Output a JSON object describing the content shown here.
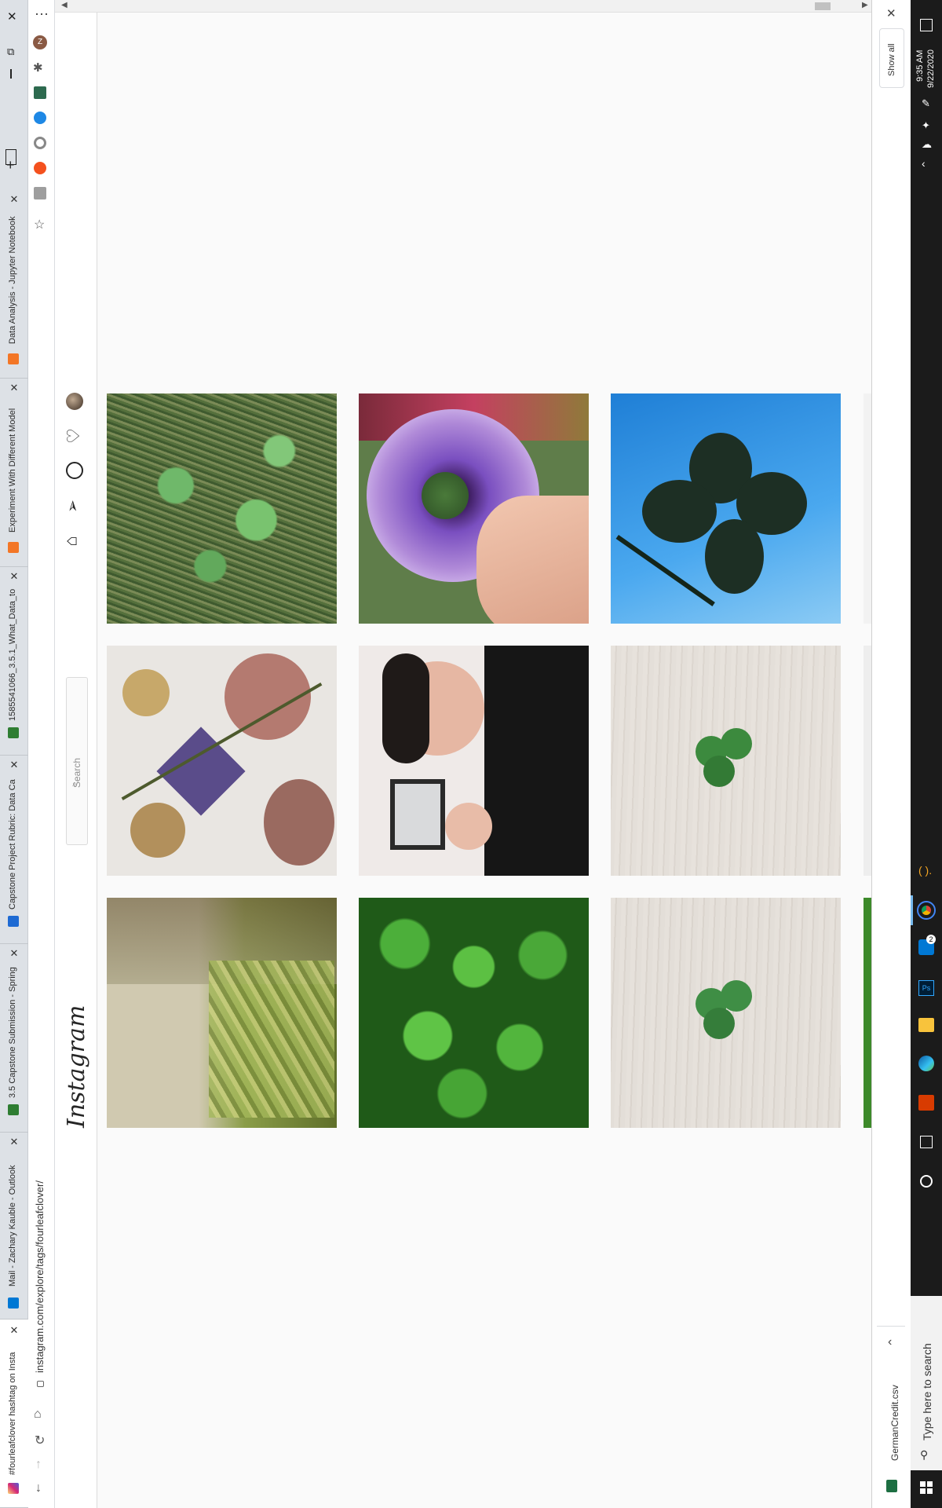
{
  "browser": {
    "tabs": [
      {
        "label": "#fourleafclover hashtag on Insta",
        "fav": "#d6249f",
        "active": true
      },
      {
        "label": "Mail - Zachary Kauble - Outlook",
        "fav": "#0078d4"
      },
      {
        "label": "3.5 Capstone Submission - Spring",
        "fav": "#2e7d32"
      },
      {
        "label": "Capstone Project Rubric: Data Ca",
        "fav": "#1e6ad3"
      },
      {
        "label": "1585541066_3.5.1_What_Data_to",
        "fav": "#2e7d32"
      },
      {
        "label": "Experiment With Different Model",
        "fav": "#f37626"
      },
      {
        "label": "Data Analysis - Jupyter Notebook",
        "fav": "#f37626"
      }
    ],
    "url": "instagram.com/explore/tags/fourleafclover/",
    "window_controls": {
      "close": "✕",
      "restore": "⧉",
      "minimize": "—"
    },
    "new_tab": "+",
    "menu": "⋯"
  },
  "instagram": {
    "logo": "Instagram",
    "search_placeholder": "Search",
    "nav_icons": [
      "home-icon",
      "direct-icon",
      "explore-icon",
      "activity-heart-icon",
      "profile-avatar-icon"
    ]
  },
  "download_bar": {
    "file_name": "GermanCredit.csv",
    "show_all": "Show all",
    "close": "✕",
    "arrow": "‹"
  },
  "taskbar": {
    "search_placeholder": "Type here to search",
    "time": "9:35 AM",
    "date": "9/22/2020",
    "mail_badge": "2"
  },
  "colors": {
    "accent": "#0095f6",
    "taskbar": "#1b1b1b"
  }
}
